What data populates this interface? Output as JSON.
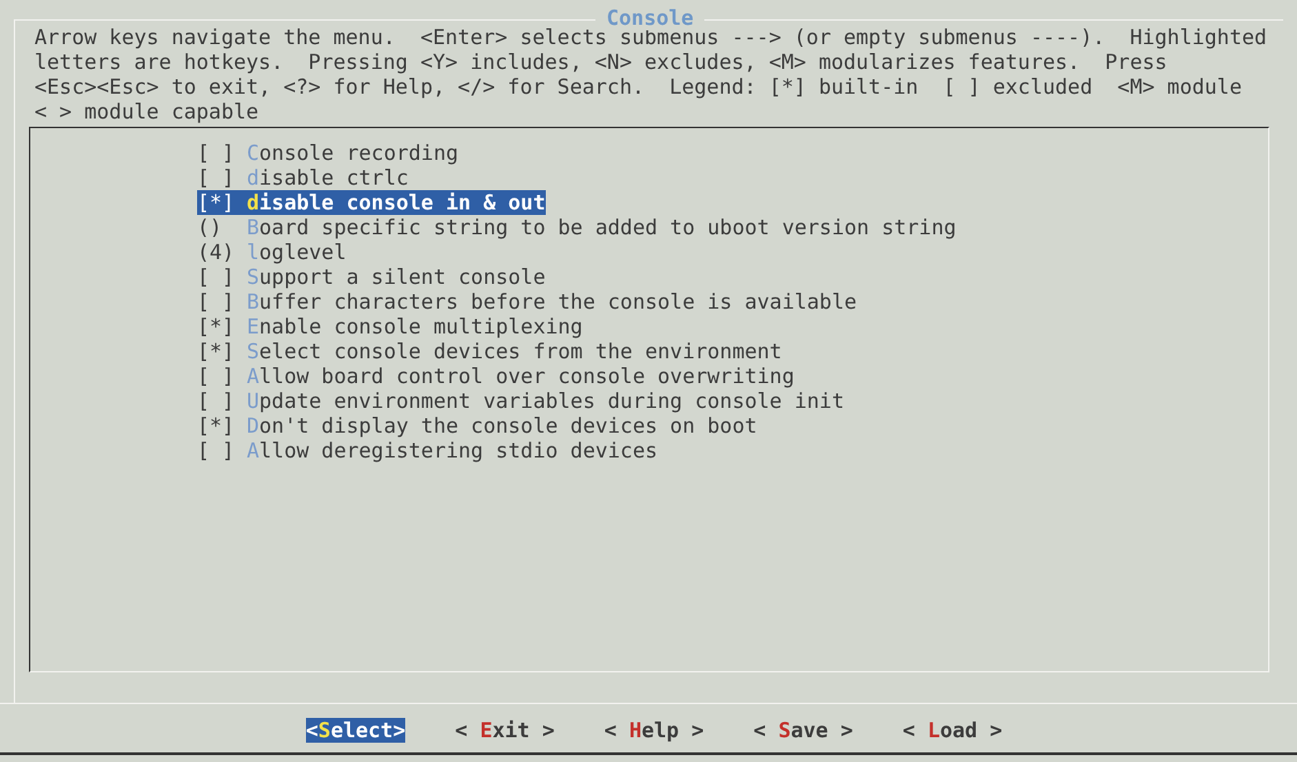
{
  "dialog": {
    "title": "Console"
  },
  "help_lines": [
    "Arrow keys navigate the menu.  <Enter> selects submenus ---> (or empty submenus ----).  Highlighted",
    "letters are hotkeys.  Pressing <Y> includes, <N> excludes, <M> modularizes features.  Press",
    "<Esc><Esc> to exit, <?> for Help, </> for Search.  Legend: [*] built-in  [ ] excluded  <M> module",
    "< > module capable"
  ],
  "items": [
    {
      "marker": "[ ]",
      "label": "Console recording",
      "selected": false
    },
    {
      "marker": "[ ]",
      "label": "disable ctrlc",
      "selected": false
    },
    {
      "marker": "[*]",
      "label": "disable console in & out",
      "selected": true
    },
    {
      "marker": "()",
      "label": "Board specific string to be added to uboot version string",
      "selected": false
    },
    {
      "marker": "(4)",
      "label": "loglevel",
      "selected": false
    },
    {
      "marker": "[ ]",
      "label": "Support a silent console",
      "selected": false
    },
    {
      "marker": "[ ]",
      "label": "Buffer characters before the console is available",
      "selected": false
    },
    {
      "marker": "[*]",
      "label": "Enable console multiplexing",
      "selected": false
    },
    {
      "marker": "[*]",
      "label": "Select console devices from the environment",
      "selected": false
    },
    {
      "marker": "[ ]",
      "label": "Allow board control over console overwriting",
      "selected": false
    },
    {
      "marker": "[ ]",
      "label": "Update environment variables during console init",
      "selected": false
    },
    {
      "marker": "[*]",
      "label": "Don't display the console devices on boot",
      "selected": false
    },
    {
      "marker": "[ ]",
      "label": "Allow deregistering stdio devices",
      "selected": false
    }
  ],
  "buttons": [
    {
      "text": "<Select>",
      "selected": true
    },
    {
      "text": "< Exit >",
      "selected": false
    },
    {
      "text": "< Help >",
      "selected": false
    },
    {
      "text": "< Save >",
      "selected": false
    },
    {
      "text": "< Load >",
      "selected": false
    }
  ]
}
